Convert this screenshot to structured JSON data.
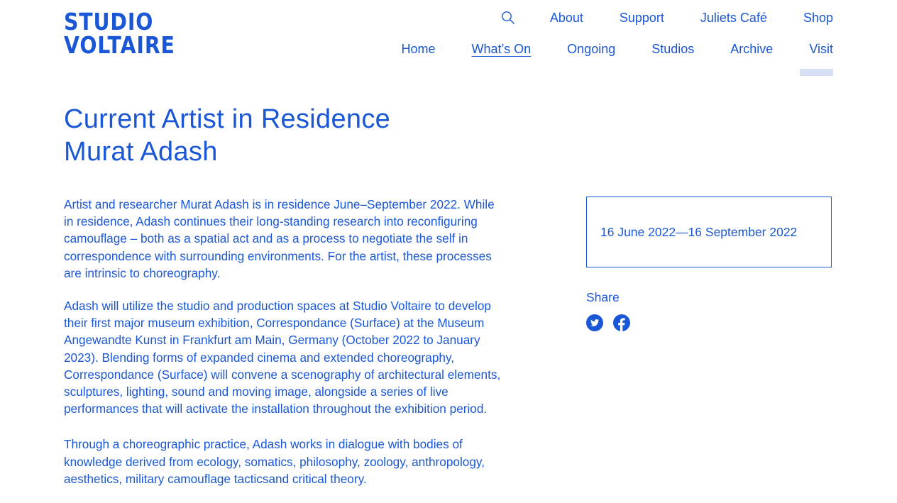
{
  "brand": {
    "line1": "STUDIO",
    "line2": "VOLTAIRE",
    "color": "#1a57d6"
  },
  "top_nav": {
    "search_icon": "search-icon",
    "items": [
      "About",
      "Support",
      "Juliets Café",
      "Shop"
    ]
  },
  "main_nav": {
    "items": [
      "Home",
      "What’s On",
      "Ongoing",
      "Studios",
      "Archive",
      "Visit"
    ],
    "active": "What’s On"
  },
  "page": {
    "title_line1": "Current Artist in Residence",
    "title_line2": "Murat Adash",
    "paragraphs": [
      "Artist and researcher Murat Adash is in residence June–September 2022. While in residence, Adash continues their long-standing research into reconfiguring camouflage – both as a spatial act and as a process to negotiate the self in correspondence with surrounding environments. For the artist, these processes are intrinsic to choreography.",
      "Adash will utilize the studio and production spaces at Studio Voltaire to develop their first major museum exhibition, Correspondance (Surface) at the Museum Angewandte Kunst in Frankfurt am Main, Germany (October 2022 to January 2023). Blending forms of expanded cinema and extended choreography, Correspondance (Surface) will convene a scenography of architectural elements, sculptures, lighting, sound and moving image, alongside a series of live performances that will activate the installation throughout the exhibition period.",
      "Through a choreographic practice, Adash works in dialogue with bodies of knowledge derived from ecology, somatics, philosophy, zoology, anthropology, aesthetics, military camouflage tacticsand critical theory."
    ]
  },
  "sidebar": {
    "dates": "16 June 2022—16 September 2022",
    "share_label": "Share",
    "share_icons": [
      "twitter-icon",
      "facebook-icon"
    ]
  }
}
